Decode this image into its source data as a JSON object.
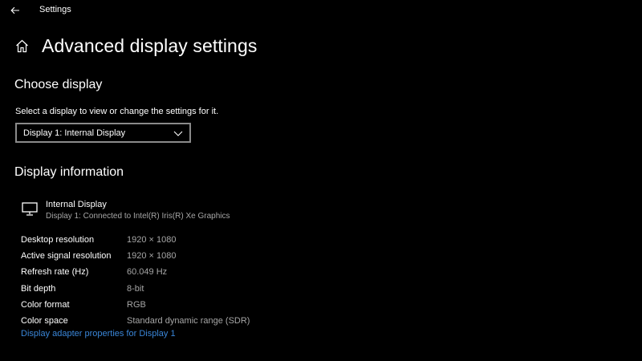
{
  "window": {
    "app_title": "Settings"
  },
  "header": {
    "page_title": "Advanced display settings"
  },
  "choose_display": {
    "heading": "Choose display",
    "description": "Select a display to view or change the settings for it.",
    "dropdown_value": "Display 1: Internal Display"
  },
  "display_information": {
    "heading": "Display information",
    "monitor_name": "Internal Display",
    "monitor_connection": "Display 1: Connected to Intel(R) Iris(R) Xe Graphics",
    "rows": [
      {
        "label": "Desktop resolution",
        "value": "1920 × 1080"
      },
      {
        "label": "Active signal resolution",
        "value": "1920 × 1080"
      },
      {
        "label": "Refresh rate (Hz)",
        "value": "60.049 Hz"
      },
      {
        "label": "Bit depth",
        "value": "8-bit"
      },
      {
        "label": "Color format",
        "value": "RGB"
      },
      {
        "label": "Color space",
        "value": "Standard dynamic range (SDR)"
      }
    ],
    "adapter_link": "Display adapter properties for Display 1"
  },
  "icons": {
    "back": "back-arrow-icon",
    "home": "home-icon",
    "dropdown": "chevron-down-icon",
    "monitor": "monitor-icon"
  },
  "colors": {
    "background": "#000000",
    "text_primary": "#ffffff",
    "text_secondary": "#a6a6a6",
    "link": "#3a86d8",
    "dropdown_border": "#8a8a8a"
  }
}
